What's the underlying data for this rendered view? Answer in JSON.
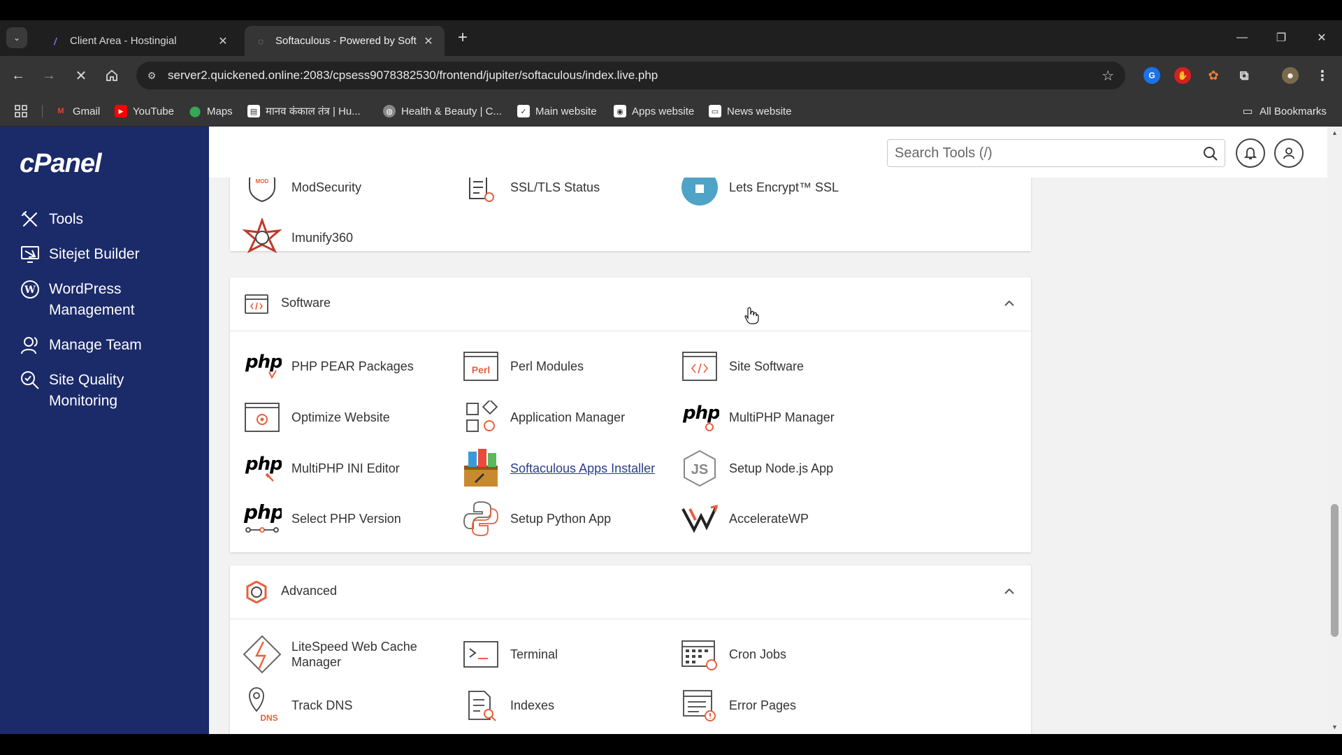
{
  "browser": {
    "tabs": [
      {
        "title": "Client Area - Hostingial",
        "active": false
      },
      {
        "title": "Softaculous - Powered by Softa",
        "active": true
      }
    ],
    "url": "server2.quickened.online:2083/cpsess9078382530/frontend/jupiter/softaculous/index.live.php",
    "bookmarks": [
      {
        "label": "Gmail",
        "icon": "gmail-icon"
      },
      {
        "label": "YouTube",
        "icon": "youtube-icon"
      },
      {
        "label": "Maps",
        "icon": "maps-icon"
      },
      {
        "label": "मानव कंकाल तंत्र | Hu...",
        "icon": "page-icon"
      },
      {
        "label": "Health & Beauty | C...",
        "icon": "globe-icon"
      },
      {
        "label": "Main website",
        "icon": "site-icon"
      },
      {
        "label": "Apps website",
        "icon": "site-icon"
      },
      {
        "label": "News website",
        "icon": "page-icon"
      }
    ],
    "all_bookmarks": "All Bookmarks"
  },
  "cpanel": {
    "logo": "cPanel",
    "sidebar": [
      {
        "label": "Tools",
        "icon": "tools-icon"
      },
      {
        "label": "Sitejet Builder",
        "icon": "sitejet-icon"
      },
      {
        "label": "WordPress Management",
        "icon": "wordpress-icon"
      },
      {
        "label": "Manage Team",
        "icon": "team-icon"
      },
      {
        "label": "Site Quality Monitoring",
        "icon": "quality-icon"
      }
    ],
    "search_placeholder": "Search Tools (/)",
    "security_partial": {
      "tools": [
        {
          "label": "ModSecurity",
          "icon": "modsecurity-icon"
        },
        {
          "label": "SSL/TLS Status",
          "icon": "ssl-status-icon"
        },
        {
          "label": "Lets Encrypt™ SSL",
          "icon": "letsencrypt-icon"
        },
        {
          "label": "Imunify360",
          "icon": "imunify-icon"
        }
      ]
    },
    "software": {
      "title": "Software",
      "tools": [
        {
          "label": "PHP PEAR Packages",
          "icon": "php-pear-icon"
        },
        {
          "label": "Perl Modules",
          "icon": "perl-icon"
        },
        {
          "label": "Site Software",
          "icon": "site-software-icon"
        },
        {
          "label": "Optimize Website",
          "icon": "optimize-icon"
        },
        {
          "label": "Application Manager",
          "icon": "app-manager-icon"
        },
        {
          "label": "MultiPHP Manager",
          "icon": "multiphp-manager-icon"
        },
        {
          "label": "MultiPHP INI Editor",
          "icon": "multiphp-ini-icon"
        },
        {
          "label": "Softaculous Apps Installer",
          "icon": "softaculous-icon"
        },
        {
          "label": "Setup Node.js App",
          "icon": "nodejs-icon"
        },
        {
          "label": "Select PHP Version",
          "icon": "select-php-icon"
        },
        {
          "label": "Setup Python App",
          "icon": "python-icon"
        },
        {
          "label": "AccelerateWP",
          "icon": "acceleratewp-icon"
        }
      ]
    },
    "advanced": {
      "title": "Advanced",
      "tools": [
        {
          "label": "LiteSpeed Web Cache Manager",
          "icon": "litespeed-icon"
        },
        {
          "label": "Terminal",
          "icon": "terminal-icon"
        },
        {
          "label": "Cron Jobs",
          "icon": "cron-icon"
        },
        {
          "label": "Track DNS",
          "icon": "track-dns-icon"
        },
        {
          "label": "Indexes",
          "icon": "indexes-icon"
        },
        {
          "label": "Error Pages",
          "icon": "error-pages-icon"
        }
      ]
    }
  },
  "colors": {
    "sidebar": "#1b2a68",
    "accent_orange": "#e8603c",
    "link": "#2b3d8a"
  }
}
